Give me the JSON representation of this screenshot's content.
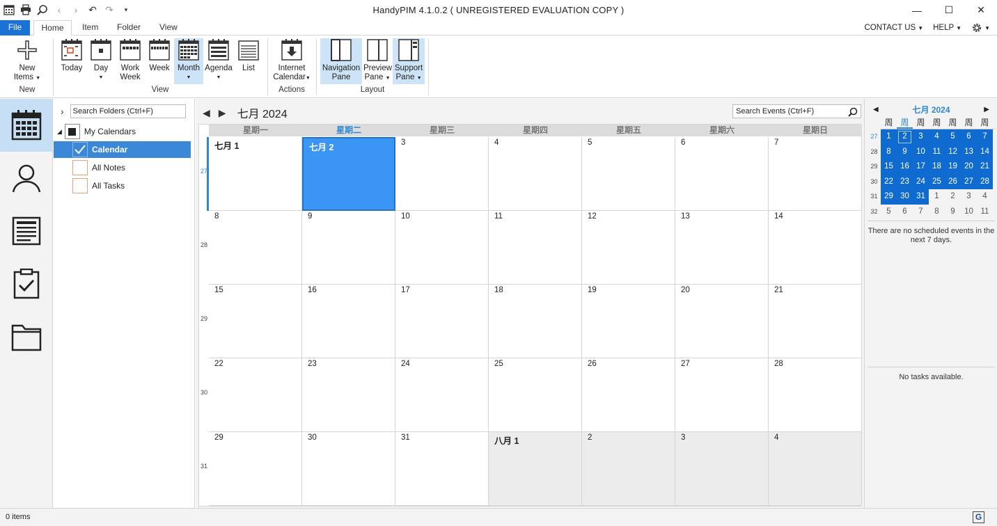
{
  "window": {
    "title": "HandyPIM 4.1.0.2 ( UNREGISTERED EVALUATION COPY )"
  },
  "ribbon_tabs": {
    "file": "File",
    "home": "Home",
    "item": "Item",
    "folder": "Folder",
    "view": "View",
    "contact_us": "CONTACT US",
    "help": "HELP"
  },
  "ribbon": {
    "new_items_1": "New",
    "new_items_2": "Items",
    "group_new": "New",
    "today": "Today",
    "day": "Day",
    "work_week_1": "Work",
    "work_week_2": "Week",
    "week": "Week",
    "month": "Month",
    "agenda": "Agenda",
    "list": "List",
    "group_view": "View",
    "internet_1": "Internet",
    "internet_2": "Calendar",
    "group_actions": "Actions",
    "nav_pane_1": "Navigation",
    "nav_pane_2": "Pane",
    "preview_pane_1": "Preview",
    "preview_pane_2": "Pane",
    "support_pane_1": "Support",
    "support_pane_2": "Pane",
    "group_layout": "Layout"
  },
  "folders": {
    "search_placeholder": "Search Folders (Ctrl+F)",
    "root": "My Calendars",
    "items": [
      "Calendar",
      "All Notes",
      "All Tasks"
    ]
  },
  "calendar": {
    "title": "七月 2024",
    "search_placeholder": "Search Events (Ctrl+F)",
    "days_of_week": [
      "星期一",
      "星期二",
      "星期三",
      "星期四",
      "星期五",
      "星期六",
      "星期日"
    ],
    "today_col": 1,
    "weeks": [
      {
        "num": "27",
        "days": [
          {
            "d": "七月 1",
            "bold": true
          },
          {
            "d": "七月 2",
            "bold": true,
            "today": true
          },
          {
            "d": "3"
          },
          {
            "d": "4"
          },
          {
            "d": "5"
          },
          {
            "d": "6"
          },
          {
            "d": "7"
          }
        ]
      },
      {
        "num": "28",
        "days": [
          {
            "d": "8"
          },
          {
            "d": "9"
          },
          {
            "d": "10"
          },
          {
            "d": "11"
          },
          {
            "d": "12"
          },
          {
            "d": "13"
          },
          {
            "d": "14"
          }
        ]
      },
      {
        "num": "29",
        "days": [
          {
            "d": "15"
          },
          {
            "d": "16"
          },
          {
            "d": "17"
          },
          {
            "d": "18"
          },
          {
            "d": "19"
          },
          {
            "d": "20"
          },
          {
            "d": "21"
          }
        ]
      },
      {
        "num": "30",
        "days": [
          {
            "d": "22"
          },
          {
            "d": "23"
          },
          {
            "d": "24"
          },
          {
            "d": "25"
          },
          {
            "d": "26"
          },
          {
            "d": "27"
          },
          {
            "d": "28"
          }
        ]
      },
      {
        "num": "31",
        "days": [
          {
            "d": "29"
          },
          {
            "d": "30"
          },
          {
            "d": "31"
          },
          {
            "d": "八月 1",
            "bold": true,
            "other": true
          },
          {
            "d": "2",
            "other": true
          },
          {
            "d": "3",
            "other": true
          },
          {
            "d": "4",
            "other": true
          }
        ]
      }
    ]
  },
  "mini_calendar": {
    "title": "七月 2024",
    "dow": [
      "周",
      "周",
      "周",
      "周",
      "周",
      "周",
      "周"
    ],
    "today_col": 1,
    "weeks": [
      {
        "num": "27",
        "cur": true,
        "days": [
          {
            "d": "1",
            "in": true
          },
          {
            "d": "2",
            "in": true,
            "today": true
          },
          {
            "d": "3",
            "in": true
          },
          {
            "d": "4",
            "in": true
          },
          {
            "d": "5",
            "in": true
          },
          {
            "d": "6",
            "in": true
          },
          {
            "d": "7",
            "in": true
          }
        ]
      },
      {
        "num": "28",
        "days": [
          {
            "d": "8",
            "in": true
          },
          {
            "d": "9",
            "in": true
          },
          {
            "d": "10",
            "in": true
          },
          {
            "d": "11",
            "in": true
          },
          {
            "d": "12",
            "in": true
          },
          {
            "d": "13",
            "in": true
          },
          {
            "d": "14",
            "in": true
          }
        ]
      },
      {
        "num": "29",
        "days": [
          {
            "d": "15",
            "in": true
          },
          {
            "d": "16",
            "in": true
          },
          {
            "d": "17",
            "in": true
          },
          {
            "d": "18",
            "in": true
          },
          {
            "d": "19",
            "in": true
          },
          {
            "d": "20",
            "in": true
          },
          {
            "d": "21",
            "in": true
          }
        ]
      },
      {
        "num": "30",
        "days": [
          {
            "d": "22",
            "in": true
          },
          {
            "d": "23",
            "in": true
          },
          {
            "d": "24",
            "in": true
          },
          {
            "d": "25",
            "in": true
          },
          {
            "d": "26",
            "in": true
          },
          {
            "d": "27",
            "in": true
          },
          {
            "d": "28",
            "in": true
          }
        ]
      },
      {
        "num": "31",
        "days": [
          {
            "d": "29",
            "in": true
          },
          {
            "d": "30",
            "in": true
          },
          {
            "d": "31",
            "in": true
          },
          {
            "d": "1"
          },
          {
            "d": "2"
          },
          {
            "d": "3"
          },
          {
            "d": "4"
          }
        ]
      },
      {
        "num": "32",
        "days": [
          {
            "d": "5"
          },
          {
            "d": "6"
          },
          {
            "d": "7"
          },
          {
            "d": "8"
          },
          {
            "d": "9"
          },
          {
            "d": "10"
          },
          {
            "d": "11"
          }
        ]
      }
    ],
    "events_msg": "There are no scheduled events in the next 7 days.",
    "tasks_msg": "No tasks available."
  },
  "status": {
    "items": "0 items",
    "g_icon": "G"
  },
  "colors": {
    "accent": "#1a73d4",
    "today_cell": "#3a95f5",
    "selected_folder": "#3b87d8",
    "mini_selected": "#0f6bd0"
  }
}
